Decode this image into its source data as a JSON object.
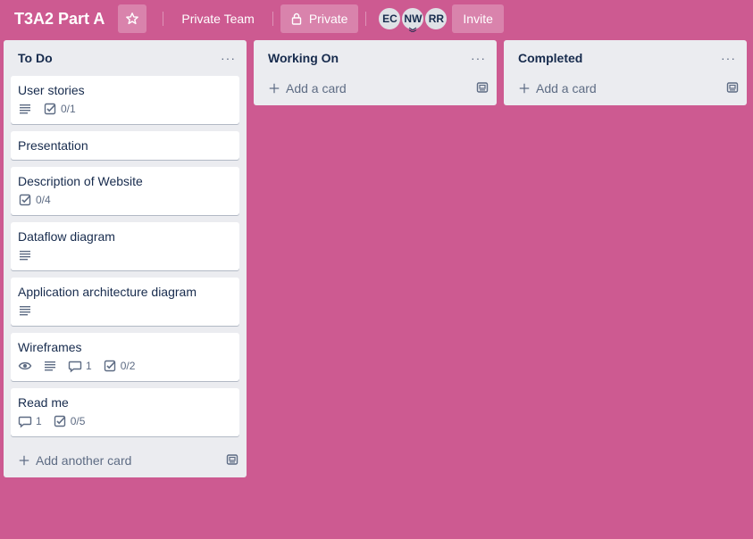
{
  "header": {
    "board_title": "T3A2 Part A",
    "team_label": "Private Team",
    "visibility_label": "Private",
    "members": [
      "EC",
      "NW",
      "RR"
    ],
    "invite_label": "Invite"
  },
  "lists": [
    {
      "title": "To Do",
      "menu": "···",
      "add_label": "Add another card",
      "cards": [
        {
          "title": "User stories",
          "checklist": "0/1"
        },
        {
          "title": "Presentation"
        },
        {
          "title": "Description of Website",
          "checklist": "0/4"
        },
        {
          "title": "Dataflow diagram"
        },
        {
          "title": "Application architecture diagram"
        },
        {
          "title": "Wireframes",
          "comments": "1",
          "checklist": "0/2"
        },
        {
          "title": "Read me",
          "comments": "1",
          "checklist": "0/5"
        }
      ]
    },
    {
      "title": "Working On",
      "menu": "···",
      "add_label": "Add a card",
      "cards": []
    },
    {
      "title": "Completed",
      "menu": "···",
      "add_label": "Add a card",
      "cards": []
    }
  ],
  "colors": {
    "board_bg": "#cd5a91",
    "list_bg": "#ebecf0",
    "text": "#172b4d",
    "muted": "#5e6c84"
  }
}
